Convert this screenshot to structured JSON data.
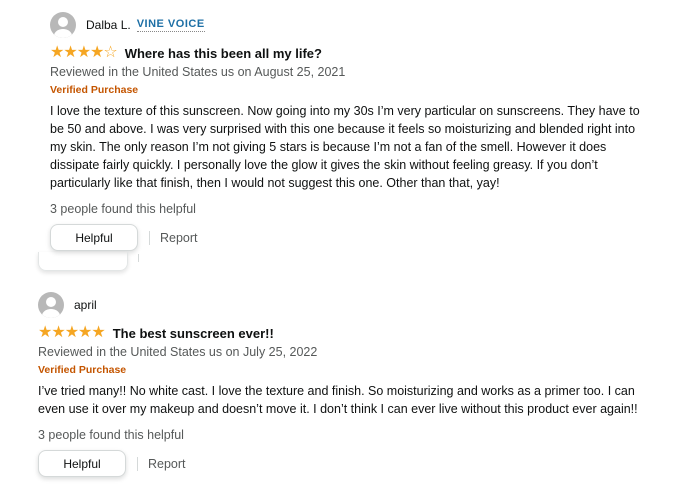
{
  "reviews": [
    {
      "author": "Dalba L.",
      "badge": "VINE VOICE",
      "rating": 4,
      "title": "Where has this been all my life?",
      "meta": "Reviewed in the United States us on August 25, 2021",
      "verified": "Verified Purchase",
      "body": "I love the texture of this sunscreen. Now going into my 30s I’m very particular on sunscreens. They have to be 50 and above. I was very surprised with this one because it feels so moisturizing and blended right into my skin. The only reason I’m not giving 5 stars is because I’m not a fan of the smell. However it does dissipate fairly quickly. I personally love the glow it gives the skin without feeling greasy. If you don’t particularly like that finish, then I would not suggest this one. Other than that, yay!",
      "helpful_count": "3 people found this helpful",
      "helpful_label": "Helpful",
      "report_label": "Report"
    },
    {
      "author": "april",
      "badge": "",
      "rating": 5,
      "title": "The best sunscreen ever!!",
      "meta": "Reviewed in the United States us on July 25, 2022",
      "verified": "Verified Purchase",
      "body": "I’ve tried many!! No white cast. I love the texture and finish. So moisturizing and works as a primer too. I can even use it over my makeup and doesn’t move it. I don’t think I can ever live without this product ever again!!",
      "helpful_count": "3 people found this helpful",
      "helpful_label": "Helpful",
      "report_label": "Report"
    }
  ],
  "colors": {
    "star": "#f5a623",
    "verified": "#c45500",
    "badge": "#1d6fa5"
  }
}
